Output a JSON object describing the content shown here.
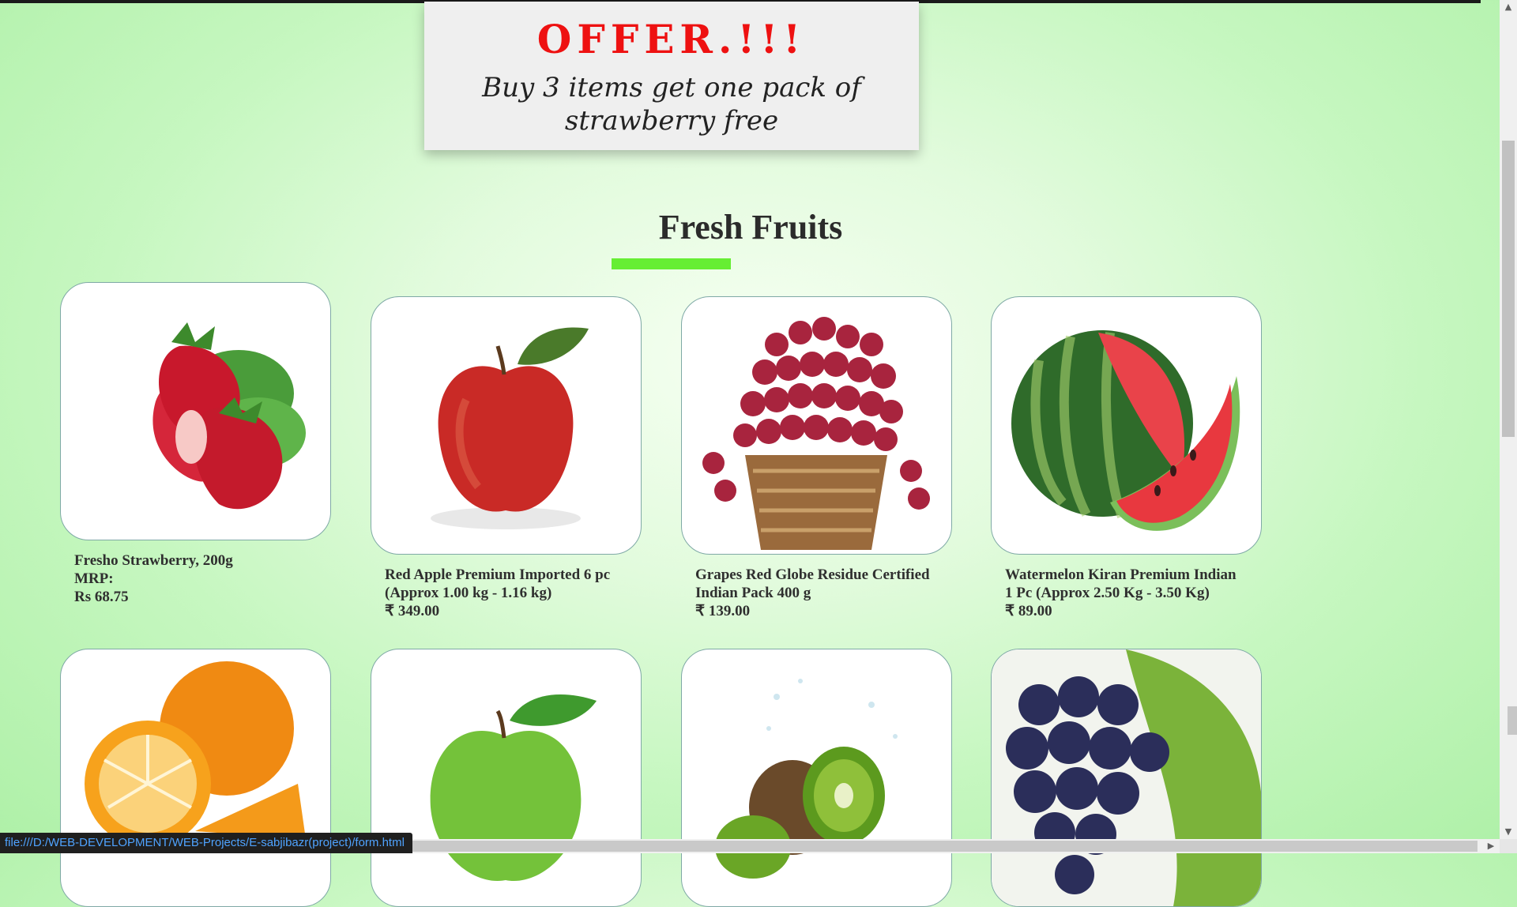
{
  "offer": {
    "title": "OFFER.!!!",
    "text": "Buy 3 items get one pack of strawberry free"
  },
  "section": {
    "heading": "Fresh Fruits",
    "accent_color": "#66ee33"
  },
  "products": [
    {
      "name": "Fresho Strawberry, 200g",
      "mrp": "MRP:",
      "price": "Rs 68.75",
      "image": "strawberry-image"
    },
    {
      "name": "Red Apple Premium Imported 6 pc (Approx 1.00 kg - 1.16 kg)",
      "price": "₹ 349.00",
      "image": "red-apple-image"
    },
    {
      "name": "Grapes Red Globe Residue Certified Indian Pack 400 g",
      "price": "₹ 139.00",
      "image": "red-grapes-image"
    },
    {
      "name": "Watermelon Kiran Premium Indian 1 Pc (Approx 2.50 Kg - 3.50 Kg)",
      "price": "₹ 89.00",
      "image": "watermelon-image"
    },
    {
      "image": "orange-image"
    },
    {
      "image": "green-apple-image"
    },
    {
      "image": "kiwi-image"
    },
    {
      "image": "black-grapes-image"
    }
  ],
  "status_bar": {
    "url": "file:///D:/WEB-DEVELOPMENT/WEB-Projects/E-sabjibazr(project)/form.html"
  },
  "colors": {
    "offer_title": "#ee1111",
    "background": "#c6f7c0",
    "card_border": "#7fa9a6"
  }
}
